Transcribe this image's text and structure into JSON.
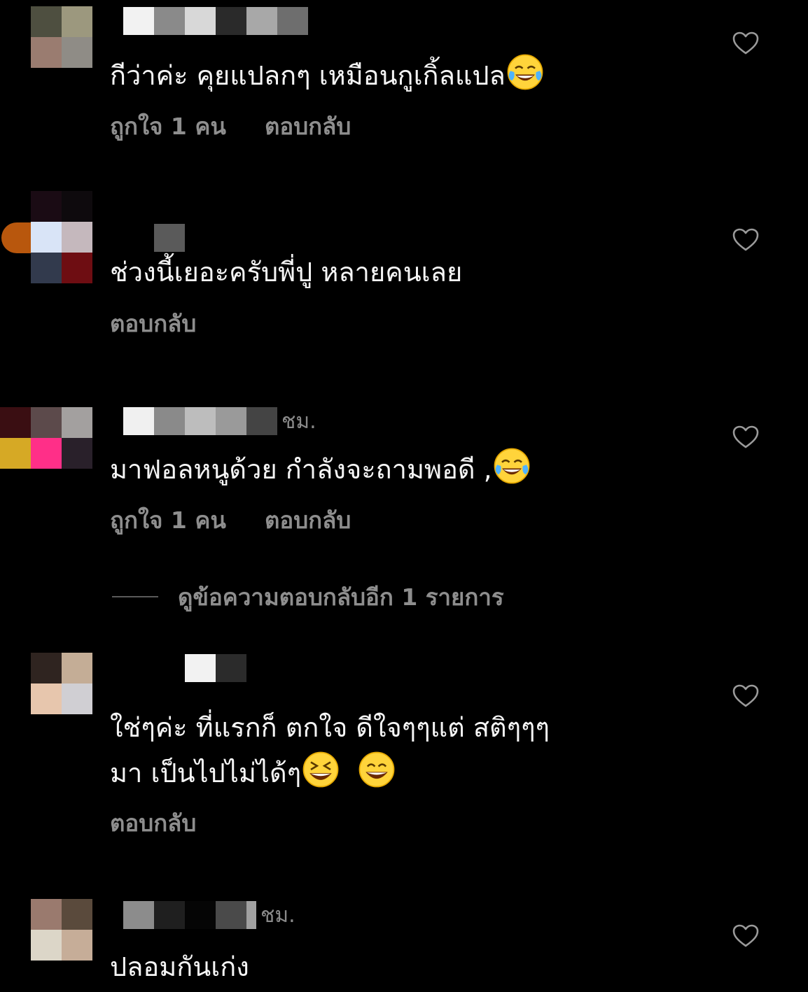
{
  "comments": [
    {
      "avatar": [
        "#4e4f40",
        "#9c987e",
        "#9a7c70",
        "#8f8c86"
      ],
      "username_blocks": [
        "#000000",
        "#f2f2f2",
        "#8a8a8a",
        "#d8d8d8",
        "#2a2a2a",
        "#a8a8a8",
        "#6e6e6e"
      ],
      "time": "",
      "text": "กีว่าค่ะ คุยแปลกๆ เหมือนกูเกิ้ลแปล",
      "emoji": [
        "face-with-tears-of-joy"
      ],
      "likes": "ถูกใจ 1 คน",
      "reply": "ตอบกลับ"
    },
    {
      "avatar": [
        "#1a0b14",
        "#0e0a0d",
        "#d9e4f7",
        "#c5b8bd",
        "#323a4d",
        "#6e0d12"
      ],
      "username_blocks": [
        "#5a5a5a"
      ],
      "time": "",
      "text": "ช่วงนี้เยอะครับพี่ปู หลายคนเลย",
      "emoji": [],
      "likes": "",
      "reply": "ตอบกลับ"
    },
    {
      "avatar": [
        "#3a0e12",
        "#5c4a4b",
        "#a3a09f",
        "#d6a925",
        "#ff2f88",
        "#29202a"
      ],
      "username_blocks": [
        "#f0f0f0",
        "#8a8a8a",
        "#bdbdbd",
        "#9a9a9a",
        "#444444"
      ],
      "time": "ชม.",
      "text": "มาฟอลหนูด้วย กำลังจะถามพอดี ,",
      "emoji": [
        "face-with-tears-of-joy"
      ],
      "likes": "ถูกใจ 1 คน",
      "reply": "ตอบกลับ"
    },
    {
      "avatar": [
        "#2f2420",
        "#c4ad96",
        "#e7c6ad",
        "#d0cfd3"
      ],
      "username_blocks": [
        "#f2f2f2",
        "#2b2b2b"
      ],
      "time": "",
      "text_line1": "ใช่ๆค่ะ ที่แรกก็ ตกใจ ดีใจๆๆแต่  สติๆๆๆ",
      "text_line2": "มา  เป็นไปไม่ได้ๆ",
      "emoji": [
        "grinning-squinting-face",
        "grinning-face-with-smiling-eyes"
      ],
      "likes": "",
      "reply": "ตอบกลับ"
    },
    {
      "avatar": [
        "#9a7a6e",
        "#5a4a3c",
        "#dcd6c8",
        "#c6ad98"
      ],
      "username_blocks": [
        "#8c8c8c",
        "#1f1f1f",
        "#050505",
        "#4a4a4a",
        "#a0a0a0"
      ],
      "time": "ชม.",
      "text": "ปลอมกันเก่ง"
    }
  ],
  "view_more_replies": "ดูข้อความตอบกลับอีก 1 รายการ",
  "colors": {
    "background": "#000000",
    "secondary_text": "#8e8e8e",
    "primary_text": "#f5f5f5"
  }
}
